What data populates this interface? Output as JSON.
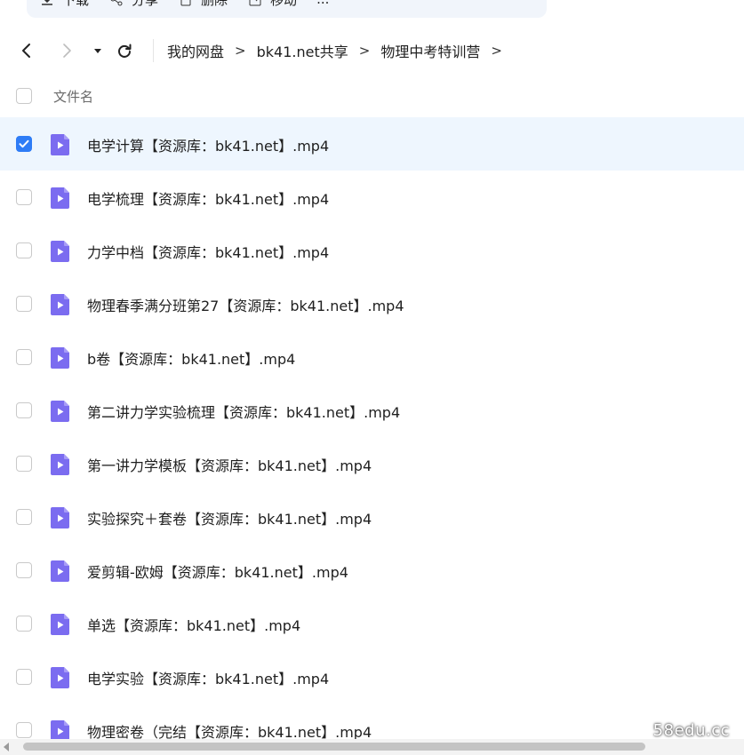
{
  "toolbar": {
    "buttons": [
      {
        "label": "下载",
        "icon": "download-icon"
      },
      {
        "label": "分享",
        "icon": "share-icon"
      },
      {
        "label": "删除",
        "icon": "delete-icon"
      },
      {
        "label": "移动",
        "icon": "move-icon"
      },
      {
        "label": "...",
        "icon": "more-icon"
      }
    ]
  },
  "nav": {
    "back_icon": "chevron-left-icon",
    "forward_icon": "chevron-right-icon",
    "dropdown_icon": "caret-down-icon",
    "refresh_icon": "refresh-icon",
    "breadcrumb": [
      "我的网盘",
      "bk41.net共享",
      "物理中考特训营"
    ],
    "separator": ">"
  },
  "header": {
    "column_label": "文件名"
  },
  "files": [
    {
      "name": "电学计算【资源库：bk41.net】.mp4",
      "selected": true
    },
    {
      "name": "电学梳理【资源库：bk41.net】.mp4",
      "selected": false
    },
    {
      "name": "力学中档【资源库：bk41.net】.mp4",
      "selected": false
    },
    {
      "name": "物理春季满分班第27【资源库：bk41.net】.mp4",
      "selected": false
    },
    {
      "name": "b卷【资源库：bk41.net】.mp4",
      "selected": false
    },
    {
      "name": "第二讲力学实验梳理【资源库：bk41.net】.mp4",
      "selected": false
    },
    {
      "name": "第一讲力学模板【资源库：bk41.net】.mp4",
      "selected": false
    },
    {
      "name": "实验探究＋套卷【资源库：bk41.net】.mp4",
      "selected": false
    },
    {
      "name": "爱剪辑-欧姆【资源库：bk41.net】.mp4",
      "selected": false
    },
    {
      "name": "单选【资源库：bk41.net】.mp4",
      "selected": false
    },
    {
      "name": "电学实验【资源库：bk41.net】.mp4",
      "selected": false
    },
    {
      "name": "物理密卷（完结【资源库：bk41.net】.mp4",
      "selected": false
    }
  ],
  "watermark": "58edu.cc",
  "colors": {
    "accent": "#2e7cf6",
    "selected_row": "#eef6fe",
    "video_icon": "#7b6cf0"
  }
}
